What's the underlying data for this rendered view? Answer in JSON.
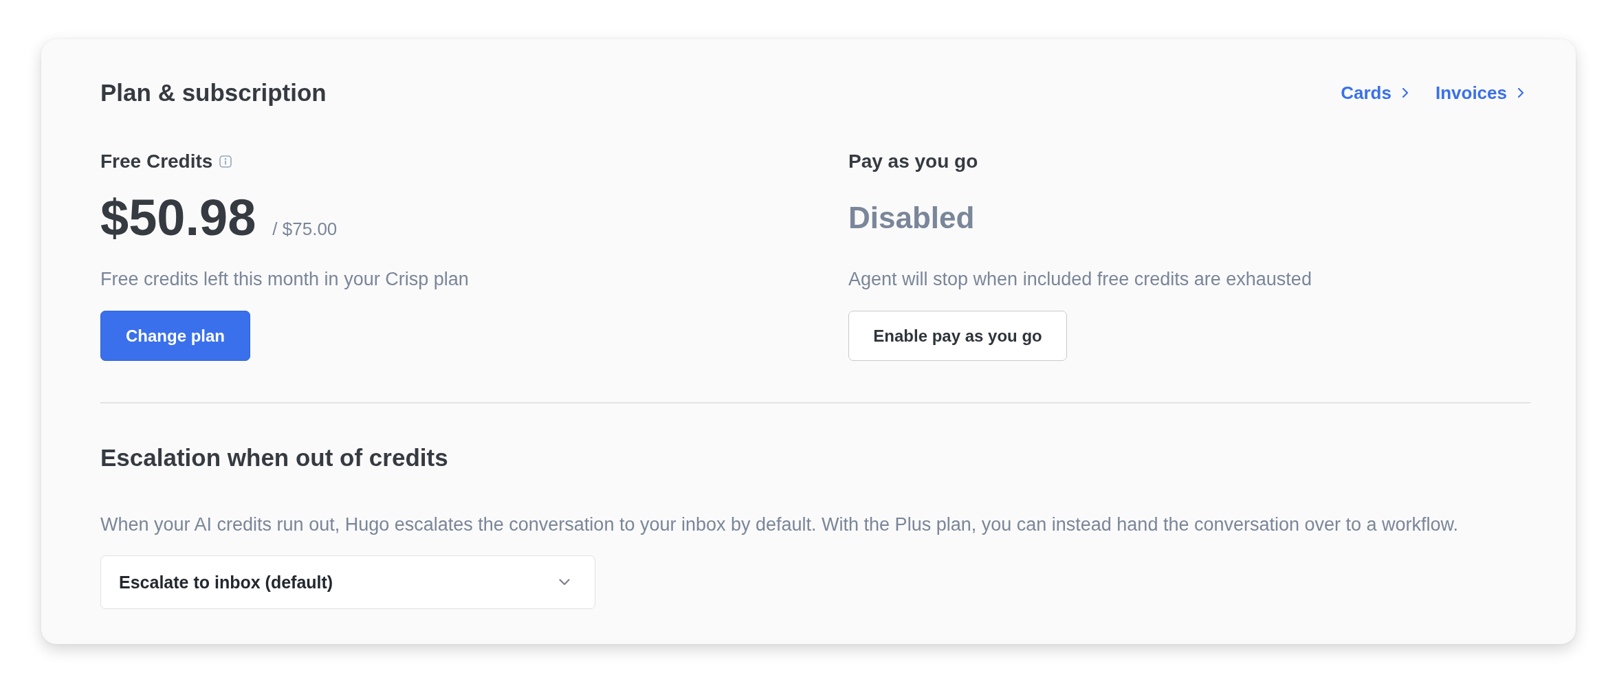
{
  "header": {
    "title": "Plan & subscription",
    "links": [
      {
        "label": "Cards"
      },
      {
        "label": "Invoices"
      }
    ]
  },
  "free_credits": {
    "label": "Free Credits",
    "amount": "$50.98",
    "total": "/ $75.00",
    "description": "Free credits left this month in your Crisp plan",
    "button": "Change plan"
  },
  "pay_as_you_go": {
    "label": "Pay as you go",
    "status": "Disabled",
    "description": "Agent will stop when included free credits are exhausted",
    "button": "Enable pay as you go"
  },
  "escalation": {
    "title": "Escalation when out of credits",
    "description": "When your AI credits run out, Hugo escalates the conversation to your inbox by default. With the Plus plan, you can instead hand the conversation over to a workflow.",
    "select": {
      "value": "Escalate to inbox (default)"
    }
  }
}
